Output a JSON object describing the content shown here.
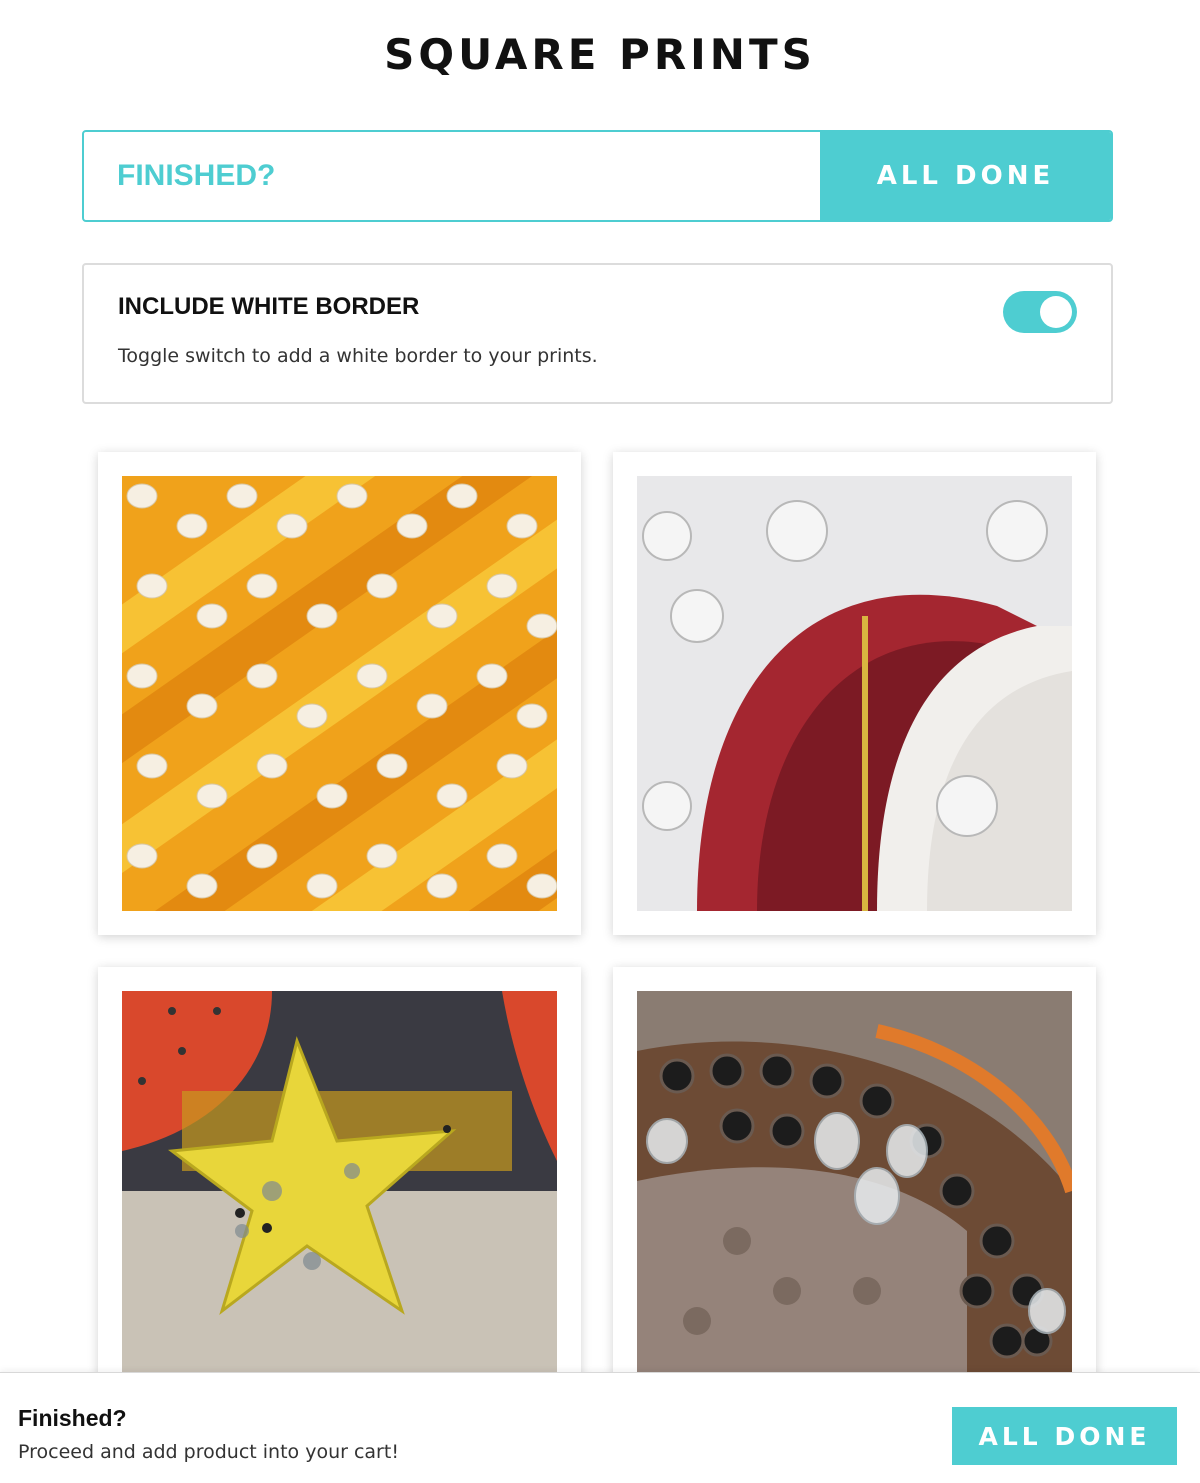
{
  "page": {
    "title": "SQUARE PRINTS"
  },
  "finish_bar": {
    "label": "FINISHED?",
    "button_label": "ALL DONE"
  },
  "border_option": {
    "title": "INCLUDE WHITE BORDER",
    "description": "Toggle switch to add a white border to your prints.",
    "enabled": true
  },
  "prints": [
    {
      "subject": "yellow marquee light bulbs"
    },
    {
      "subject": "white sign with red arch and bulbs"
    },
    {
      "subject": "yellow star sign"
    },
    {
      "subject": "rusty sign with clear bulbs"
    }
  ],
  "footer": {
    "title": "Finished?",
    "description": "Proceed and add product into your cart!",
    "button_label": "ALL DONE"
  },
  "colors": {
    "accent": "#4ecdd1",
    "border": "#dcdcdc",
    "text": "#111111"
  }
}
